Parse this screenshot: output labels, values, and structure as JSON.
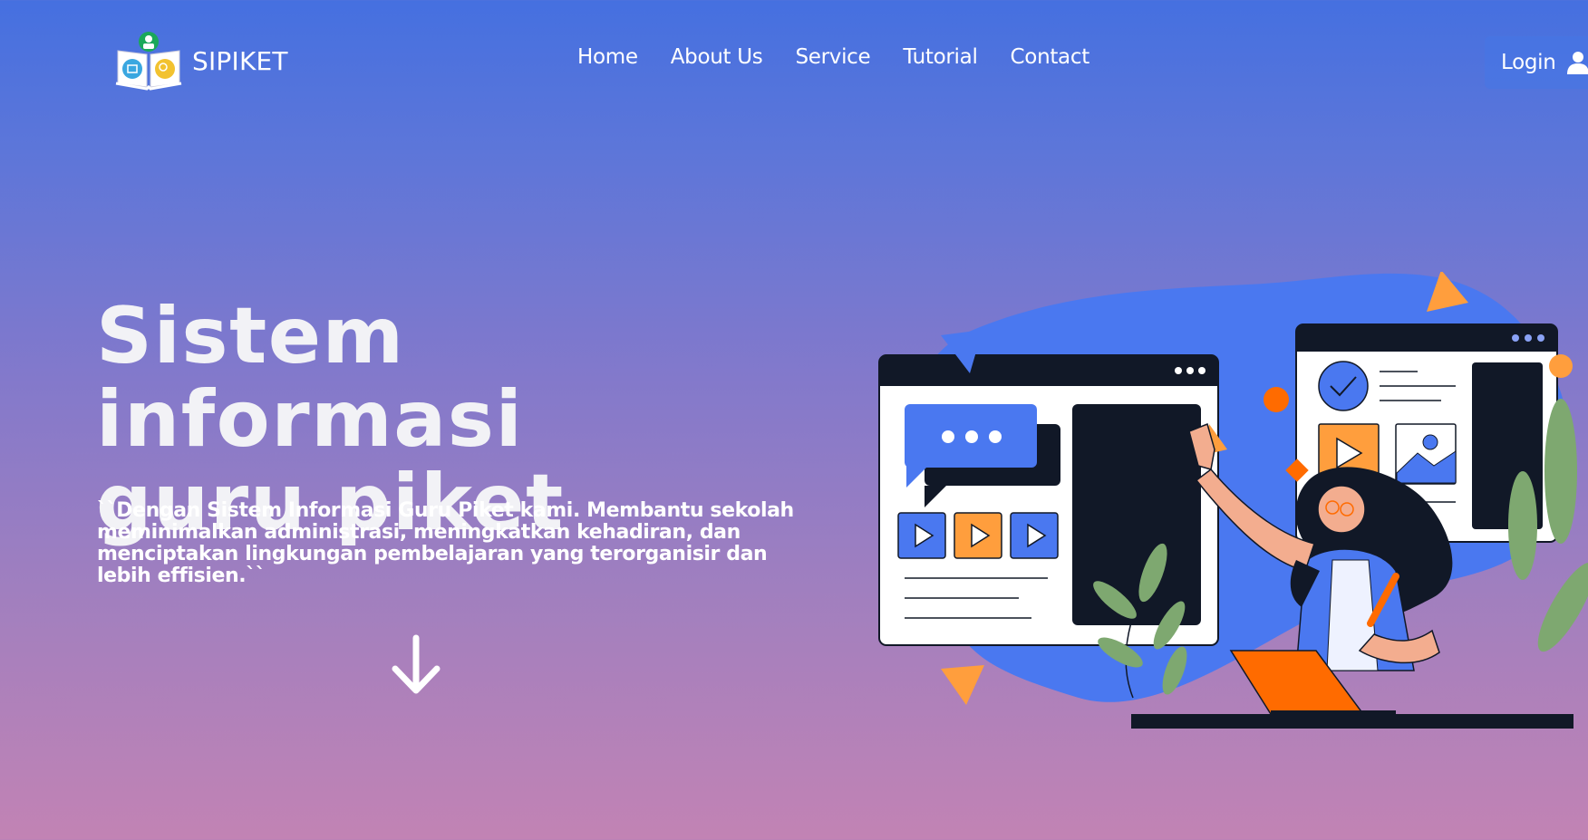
{
  "brand": {
    "name": "SIPIKET",
    "logo_icon": "book-logo-icon"
  },
  "nav": {
    "items": [
      {
        "label": "Home"
      },
      {
        "label": "About Us"
      },
      {
        "label": "Service"
      },
      {
        "label": "Tutorial"
      },
      {
        "label": "Contact"
      }
    ],
    "login_label": "Login",
    "login_icon": "user-icon"
  },
  "hero": {
    "title_line1": "Sistem informasi",
    "title_line2": "guru piket",
    "description": "``Dengan Sistem Informasi Guru Piket kami. Membantu sekolah meminimalkan administrasi, meningkatkan kehadiran, dan menciptakan lingkungan pembelajaran yang terorganisir dan lebih effisien.``",
    "scroll_icon": "arrow-down-icon",
    "illustration_icon": "online-learning-illustration"
  },
  "colors": {
    "gradient_top": "#4570e0",
    "gradient_bottom": "#c283b4",
    "accent_blue": "#4a78f0",
    "accent_orange": "#ff6b00",
    "dark_panel": "#111827"
  }
}
